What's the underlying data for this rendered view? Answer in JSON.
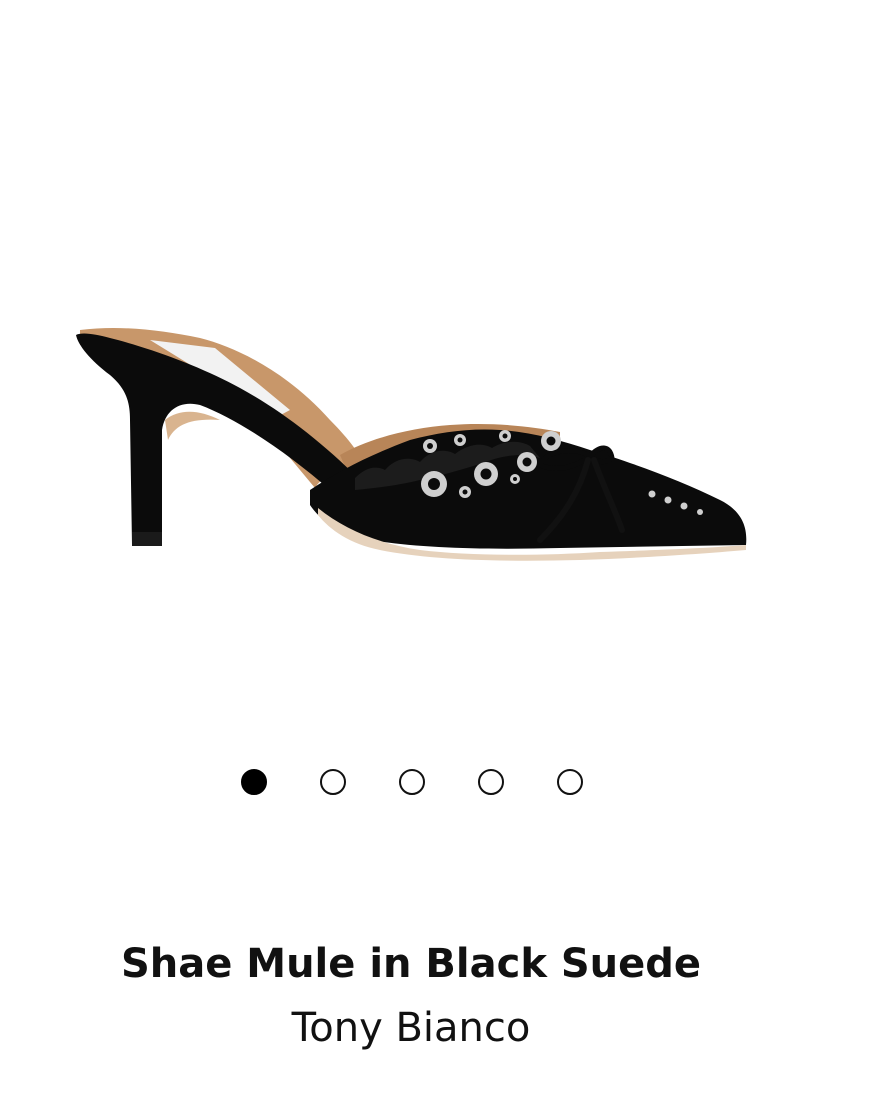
{
  "product": {
    "image_alt": "Shae Mule in Black Suede",
    "title": "Shae Mule in Black Suede",
    "brand": "Tony Bianco"
  },
  "gallery": {
    "total_images": 5,
    "active_index": 1,
    "dots": [
      {
        "state": "active"
      },
      {
        "state": "inactive"
      },
      {
        "state": "inactive"
      },
      {
        "state": "inactive"
      },
      {
        "state": "inactive"
      }
    ]
  },
  "colors": {
    "suede": "#0b0b0b",
    "lining": "#c8976a",
    "grommet": "#cfcfcf",
    "sole": "#e6d2bc",
    "text": "#111111"
  }
}
